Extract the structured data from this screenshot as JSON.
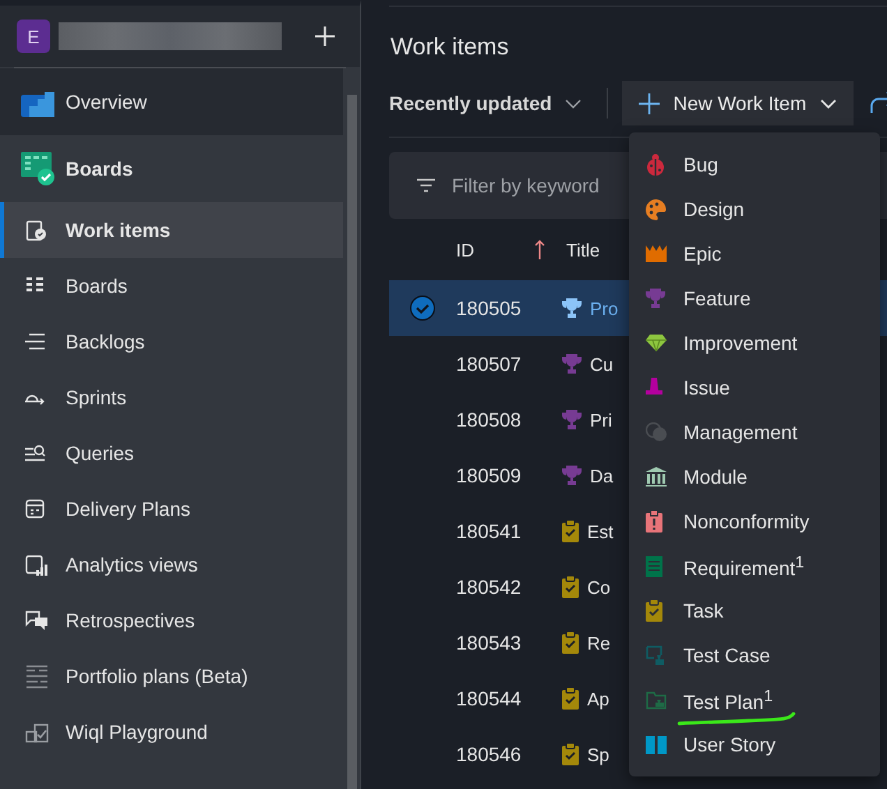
{
  "sidebar": {
    "org_initial": "E",
    "items": [
      {
        "label": "Overview",
        "kind": "hub",
        "selected": false
      },
      {
        "label": "Boards",
        "kind": "hub",
        "selected": false
      },
      {
        "label": "Work items",
        "kind": "sub",
        "selected": true
      },
      {
        "label": "Boards",
        "kind": "sub",
        "selected": false
      },
      {
        "label": "Backlogs",
        "kind": "sub",
        "selected": false
      },
      {
        "label": "Sprints",
        "kind": "sub",
        "selected": false
      },
      {
        "label": "Queries",
        "kind": "sub",
        "selected": false
      },
      {
        "label": "Delivery Plans",
        "kind": "sub",
        "selected": false
      },
      {
        "label": "Analytics views",
        "kind": "sub",
        "selected": false
      },
      {
        "label": "Retrospectives",
        "kind": "sub",
        "selected": false
      },
      {
        "label": "Portfolio plans (Beta)",
        "kind": "sub",
        "selected": false
      },
      {
        "label": "Wiql Playground",
        "kind": "sub",
        "selected": false
      }
    ]
  },
  "page_title": "Work items",
  "toolbar": {
    "view": "Recently updated",
    "new_button": "New Work Item"
  },
  "filter": {
    "placeholder": "Filter by keyword"
  },
  "table": {
    "columns": [
      "ID",
      "Title"
    ],
    "rows": [
      {
        "id": "180505",
        "kind": "feature",
        "title": "Pro",
        "selected": true
      },
      {
        "id": "180507",
        "kind": "feature",
        "title": "Cu",
        "selected": false
      },
      {
        "id": "180508",
        "kind": "feature",
        "title": "Pri",
        "selected": false
      },
      {
        "id": "180509",
        "kind": "feature",
        "title": "Da",
        "selected": false
      },
      {
        "id": "180541",
        "kind": "task",
        "title": "Est",
        "selected": false
      },
      {
        "id": "180542",
        "kind": "task",
        "title": "Co",
        "selected": false
      },
      {
        "id": "180543",
        "kind": "task",
        "title": "Re",
        "selected": false
      },
      {
        "id": "180544",
        "kind": "task",
        "title": "Ap",
        "selected": false
      },
      {
        "id": "180546",
        "kind": "task",
        "title": "Sp",
        "selected": false
      }
    ]
  },
  "new_item_menu": [
    {
      "label": "Bug",
      "underlined": false
    },
    {
      "label": "Design",
      "underlined": false
    },
    {
      "label": "Epic",
      "underlined": false
    },
    {
      "label": "Feature",
      "underlined": false
    },
    {
      "label": "Improvement",
      "underlined": false
    },
    {
      "label": "Issue",
      "underlined": false
    },
    {
      "label": "Management",
      "underlined": false
    },
    {
      "label": "Module",
      "underlined": false
    },
    {
      "label": "Nonconformity",
      "underlined": false
    },
    {
      "label": "Requirement$^{1}$",
      "underlined": false
    },
    {
      "label": "Task",
      "underlined": false
    },
    {
      "label": "Test Case",
      "underlined": false
    },
    {
      "label": "Test Plan$^{1}$",
      "underlined": true
    },
    {
      "label": "User Story",
      "underlined": false
    }
  ]
}
